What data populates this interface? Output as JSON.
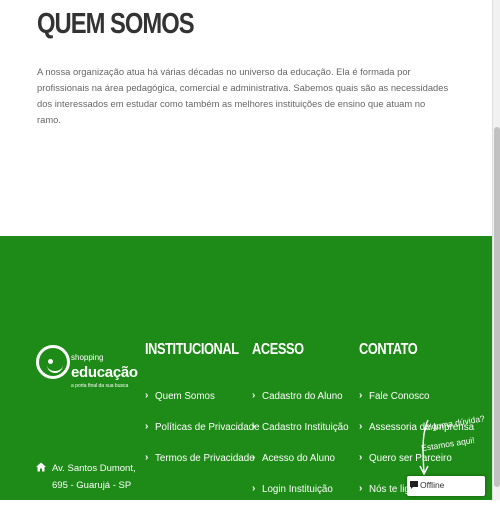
{
  "about": {
    "title": "QUEM SOMOS",
    "text": "A nossa organização atua há várias décadas no universo da educação. Ela é formada por profissionais na área pedagógica, comercial e administrativa. Sabemos quais são as necessidades dos interessados em estudar como também as melhores instituições de ensino que atuam no ramo."
  },
  "footer": {
    "logo": {
      "small": "shopping",
      "big": "educação",
      "tagline": "a porta final da sua busca"
    },
    "address": "Av. Santos Dumont, 695 - Guarujá - SP",
    "columns": [
      {
        "title": "INSTITUCIONAL",
        "items": [
          "Quem Somos",
          "Políticas de Privacidade",
          "Termos de Privacidade"
        ]
      },
      {
        "title": "ACESSO",
        "items": [
          "Cadastro do Aluno",
          "Cadastro Instituição",
          "Acesso do Aluno",
          "Login Instituição"
        ]
      },
      {
        "title": "CONTATO",
        "items": [
          "Fale Conosco",
          "Assessoria de Imprensa",
          "Quero ser Parceiro",
          "Nós te ligamos"
        ]
      }
    ]
  },
  "chat": {
    "hint_line1": "Alguma dúvida?",
    "hint_line2": "Estamos aqui!",
    "status": "Offline"
  },
  "colors": {
    "footer_green": "#1e8a17"
  },
  "icons": {
    "address": "home-icon",
    "bullet": "chevron-right-icon",
    "chat": "chat-icon",
    "hint": "arrow-down-icon"
  }
}
